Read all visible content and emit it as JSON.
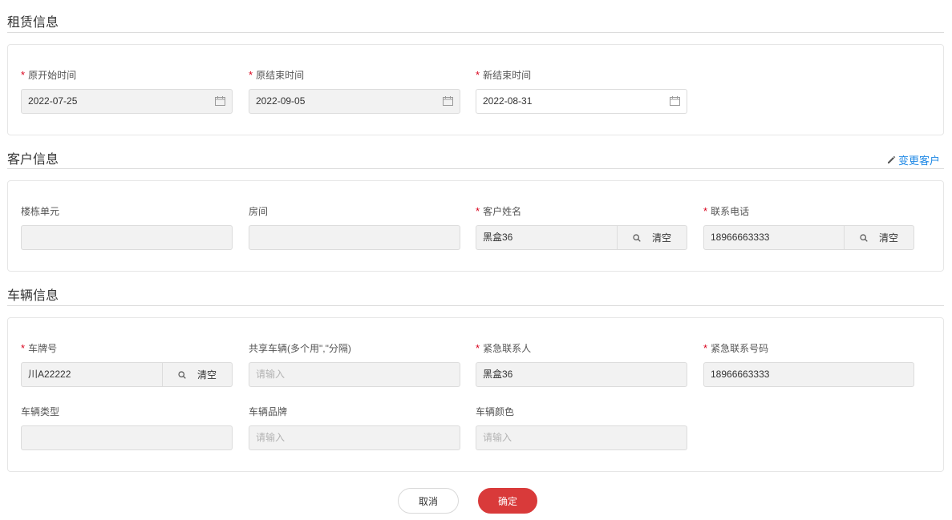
{
  "lease": {
    "title": "租赁信息",
    "fields": [
      {
        "label": "原开始时间",
        "required": true,
        "value": "2022-07-25"
      },
      {
        "label": "原结束时间",
        "required": true,
        "value": "2022-09-05"
      },
      {
        "label": "新结束时间",
        "required": true,
        "value": "2022-08-31"
      }
    ]
  },
  "customer": {
    "title": "客户信息",
    "change_link": "变更客户",
    "building_label": "楼栋单元",
    "building_value": "",
    "room_label": "房间",
    "room_value": "",
    "name_label": "客户姓名",
    "name_value": "黑盒36",
    "phone_label": "联系电话",
    "phone_value": "18966663333",
    "clear_label": "清空"
  },
  "vehicle": {
    "title": "车辆信息",
    "plate_label": "车牌号",
    "plate_value": "川A22222",
    "shared_label": "共享车辆(多个用\",\"分隔)",
    "shared_placeholder": "请输入",
    "emergency_contact_label": "紧急联系人",
    "emergency_contact_value": "黑盒36",
    "emergency_phone_label": "紧急联系号码",
    "emergency_phone_value": "18966663333",
    "type_label": "车辆类型",
    "type_value": "",
    "brand_label": "车辆品牌",
    "brand_placeholder": "请输入",
    "color_label": "车辆颜色",
    "color_placeholder": "请输入",
    "clear_label": "清空"
  },
  "footer": {
    "cancel_label": "取消",
    "confirm_label": "确定"
  },
  "colors": {
    "required": "#d9001b",
    "link": "#1e88e5",
    "primary_button": "#d93a3a"
  }
}
